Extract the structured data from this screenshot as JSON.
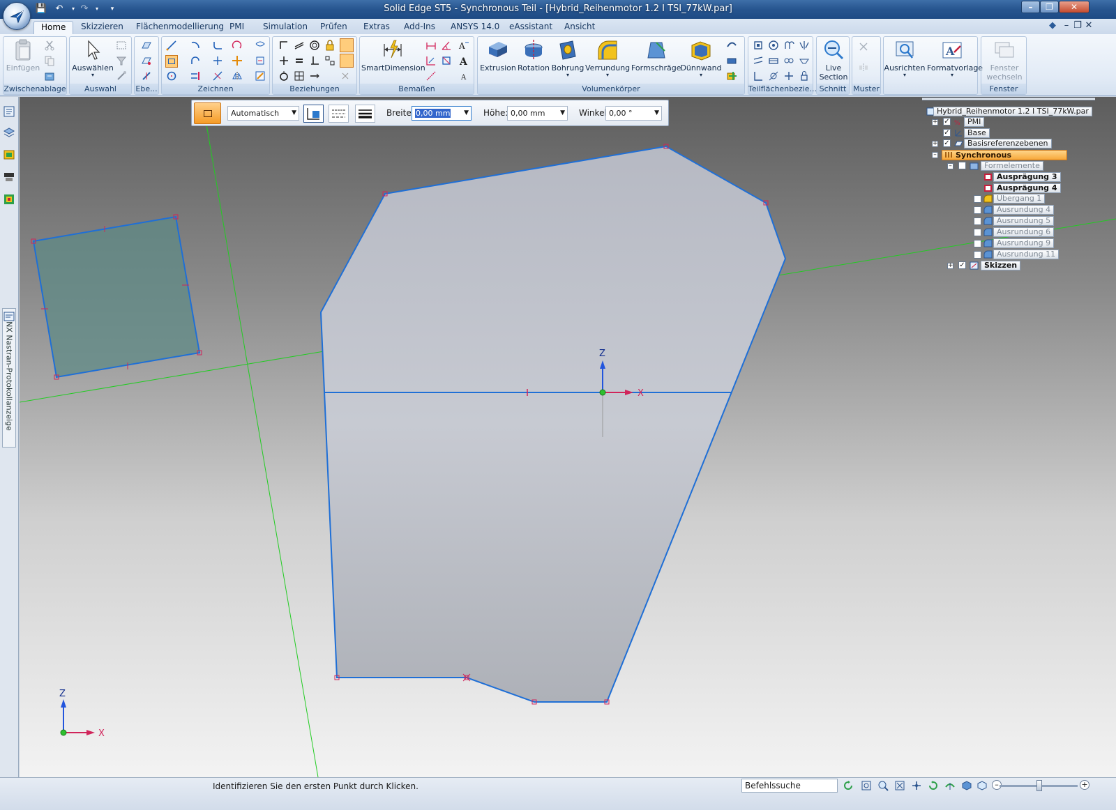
{
  "window": {
    "title": "Solid Edge ST5 - Synchronous Teil - [Hybrid_Reihenmotor 1.2 I TSI_77kW.par]"
  },
  "tabs": [
    {
      "label": "Home",
      "active": true
    },
    {
      "label": "Skizzieren"
    },
    {
      "label": "Flächenmodellierung"
    },
    {
      "label": "PMI"
    },
    {
      "label": "Simulation"
    },
    {
      "label": "Prüfen"
    },
    {
      "label": "Extras"
    },
    {
      "label": "Add-Ins"
    },
    {
      "label": "ANSYS 14.0"
    },
    {
      "label": "eAssistant"
    },
    {
      "label": "Ansicht"
    }
  ],
  "ribbon": {
    "groups": {
      "zwischenablage": "Zwischenablage",
      "auswahl": "Auswahl",
      "ebene": "Ebe...",
      "zeichnen": "Zeichnen",
      "beziehungen": "Beziehungen",
      "bemassen": "Bemaßen",
      "volumenkoerper": "Volumenkörper",
      "teilflaechen": "Teilflächenbezie...",
      "schnitt": "Schnitt",
      "muster": "Muster",
      "fenster": "Fenster"
    },
    "buttons": {
      "einfuegen": "Einfügen",
      "auswaehlen": "Auswählen",
      "smartdimension": "SmartDimension",
      "extrusion": "Extrusion",
      "rotation": "Rotation",
      "bohrung": "Bohrung",
      "verrundung": "Verrundung",
      "formschraege": "Formschräge",
      "duennwand": "Dünnwand",
      "live_section_1": "Live",
      "live_section_2": "Section",
      "ausrichten": "Ausrichten",
      "formatvorlage": "Formatvorlage",
      "fenster_wechseln_1": "Fenster",
      "fenster_wechseln_2": "wechseln"
    }
  },
  "command_bar": {
    "mode_value": "Automatisch",
    "breite_label": "Breite:",
    "breite_value": "0,00 mm",
    "hoehe_label": "Höhe:",
    "hoehe_value": "0,00 mm",
    "winkel_label": "Winkel:",
    "winkel_value": "0,00 °"
  },
  "tree": {
    "root": "Hybrid_Reihenmotor 1.2 I TSI_77kW.par",
    "pmi": "PMI",
    "base": "Base",
    "basisreferenzebenen": "Basisreferenzebenen",
    "synchronous": "Synchronous",
    "formelemente": "Formelemente",
    "items": [
      {
        "label": "Ausprägung 3",
        "bold": true
      },
      {
        "label": "Ausprägung 4",
        "bold": true
      },
      {
        "label": "Übergang 1",
        "bold": false
      },
      {
        "label": "Ausrundung 4",
        "bold": false
      },
      {
        "label": "Ausrundung 5",
        "bold": false
      },
      {
        "label": "Ausrundung 6",
        "bold": false
      },
      {
        "label": "Ausrundung 9",
        "bold": false
      },
      {
        "label": "Ausrundung 11",
        "bold": false
      }
    ],
    "skizzen": "Skizzen"
  },
  "side_panel": {
    "nastran_label": "NX Nastran-Protokollanzeige"
  },
  "viewport": {
    "axis_z": "Z",
    "axis_x": "X",
    "triad_z": "Z",
    "triad_x": "X"
  },
  "status": {
    "message": "Identifizieren Sie den ersten Punkt durch Klicken.",
    "command_search": "Befehlssuche"
  },
  "colors": {
    "accent_orange": "#f59b26",
    "sketch_blue": "#1f6fd6",
    "keypoint_red": "#d0245a",
    "reference_green": "#22cc22"
  }
}
